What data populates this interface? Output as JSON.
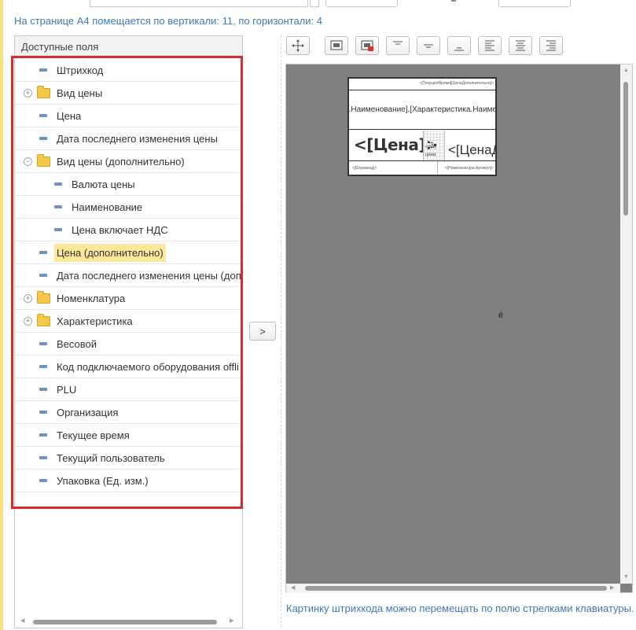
{
  "info_line": "На странице А4 помещается по вертикали: 11, по горизонтали: 4",
  "fields_panel": {
    "header": "Доступные поля",
    "items": [
      {
        "label": "Штрихкод",
        "type": "field",
        "level": 0
      },
      {
        "label": "Вид цены",
        "type": "folder",
        "level": 0,
        "expander": "⊕"
      },
      {
        "label": "Цена",
        "type": "field",
        "level": 0
      },
      {
        "label": "Дата последнего изменения цены",
        "type": "field",
        "level": 0
      },
      {
        "label": "Вид цены (дополнительно)",
        "type": "folder",
        "level": 0,
        "expander": "⊖"
      },
      {
        "label": "Валюта цены",
        "type": "field",
        "level": 1
      },
      {
        "label": "Наименование",
        "type": "field",
        "level": 1
      },
      {
        "label": "Цена включает НДС",
        "type": "field",
        "level": 1
      },
      {
        "label": "Цена (дополнительно)",
        "type": "field",
        "level": 0,
        "selected": true
      },
      {
        "label": "Дата последнего изменения цены (доп",
        "type": "field",
        "level": 0
      },
      {
        "label": "Номенклатура",
        "type": "folder",
        "level": 0,
        "expander": "⊕"
      },
      {
        "label": "Характеристика",
        "type": "folder",
        "level": 0,
        "expander": "⊕"
      },
      {
        "label": "Весовой",
        "type": "field",
        "level": 0
      },
      {
        "label": "Код подключаемого оборудования offli",
        "type": "field",
        "level": 0
      },
      {
        "label": "PLU",
        "type": "field",
        "level": 0
      },
      {
        "label": "Организация",
        "type": "field",
        "level": 0
      },
      {
        "label": "Текущее время",
        "type": "field",
        "level": 0
      },
      {
        "label": "Текущий пользователь",
        "type": "field",
        "level": 0
      },
      {
        "label": "Упаковка (Ед. изм.)",
        "type": "field",
        "level": 0
      }
    ]
  },
  "move_button": {
    "label": ">"
  },
  "toolbar": {
    "buttons": [
      "move-icon",
      "insert-area-icon",
      "delete-area-icon",
      "align-top-icon",
      "align-middle-icon",
      "align-bottom-icon",
      "align-left-icon",
      "align-center-icon",
      "align-right-icon"
    ]
  },
  "label_preview": {
    "top_text": "<[ТекущееВремя][ЦенаДополнительно]>",
    "name_text": "атура.Наименование],[Характеристика.Наиме",
    "price_text": "<[Цена]>",
    "spec_line1": "спец",
    "spec_line2": "цена",
    "price2_text": "<[ЦенаД",
    "barcode_text": "<[Штрихкод]>",
    "article_text": "<[Номенклатура.Артикул]>"
  },
  "canvas_glyph": "ё",
  "hint": "Картинку штрихкода можно перемещать по полю стрелками клавиатуры.",
  "colors": {
    "selection": "#fde79a",
    "highlight_frame": "#d92b2b",
    "link_text": "#3d7ab3",
    "canvas": "#808080"
  }
}
